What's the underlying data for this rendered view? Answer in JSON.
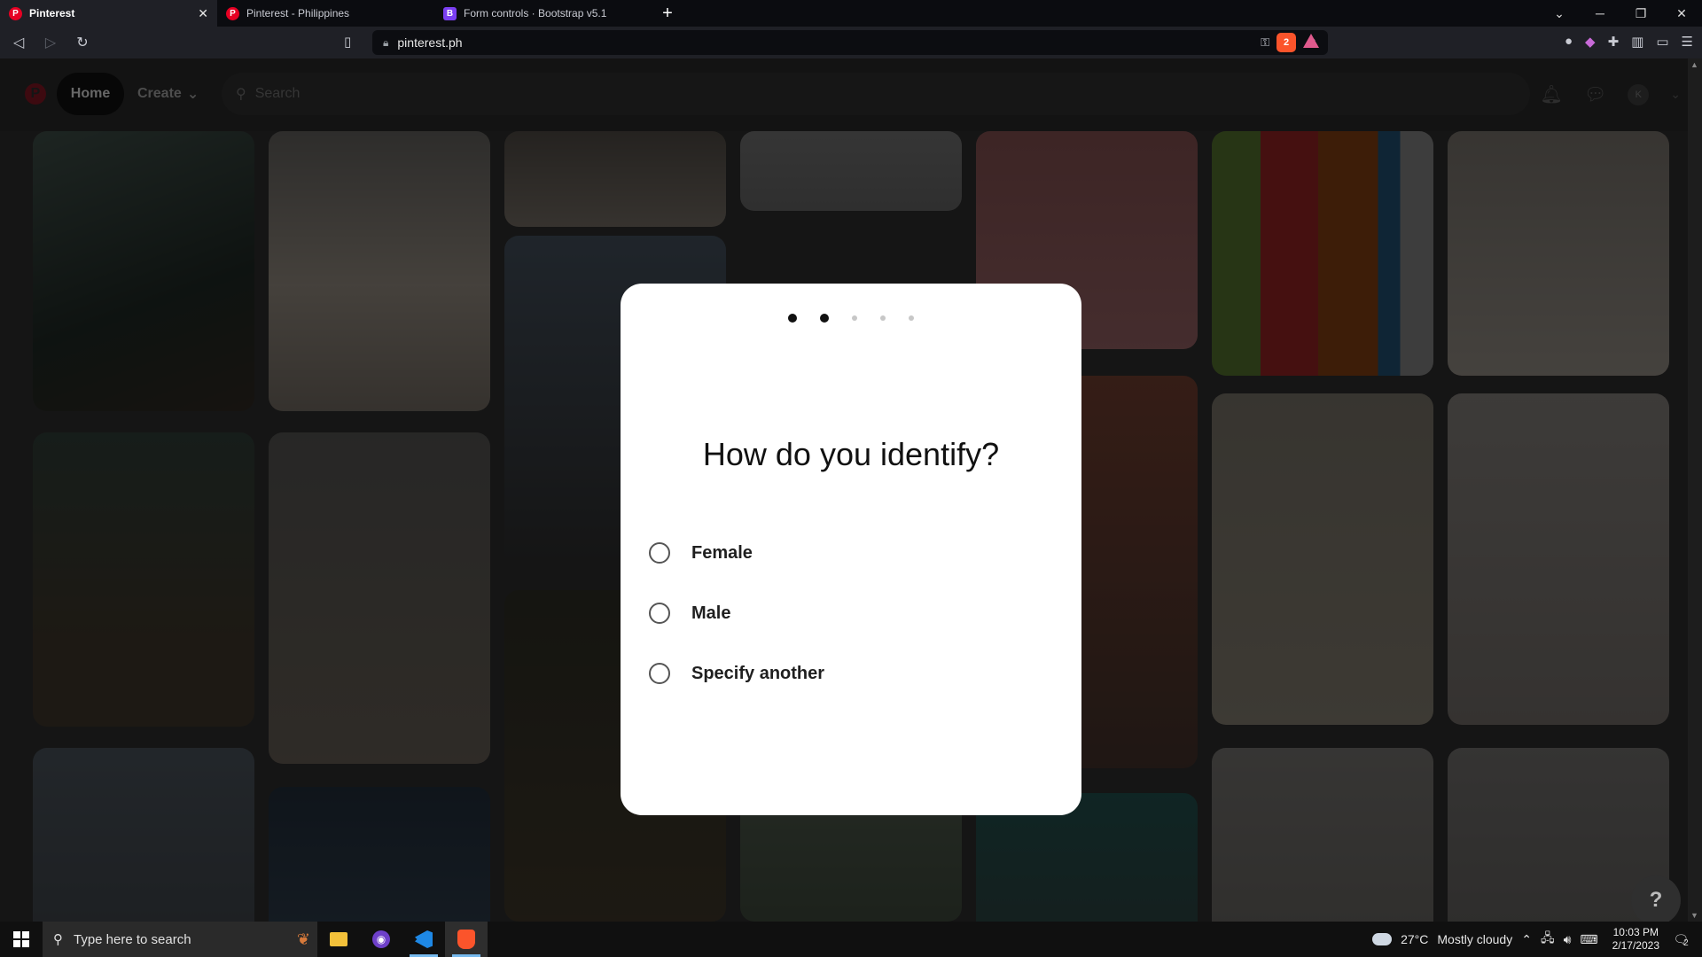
{
  "browser": {
    "tabs": [
      {
        "title": "Pinterest",
        "favicon": "pinterest-icon",
        "active": true
      },
      {
        "title": "Pinterest - Philippines",
        "favicon": "pinterest-icon",
        "active": false
      },
      {
        "title": "Form controls · Bootstrap v5.1",
        "favicon": "bootstrap-icon",
        "active": false
      }
    ],
    "url": "pinterest.ph",
    "brave_shield_count": "2"
  },
  "pinterest": {
    "logo_letter": "P",
    "home_label": "Home",
    "create_label": "Create",
    "search_placeholder": "Search",
    "avatar_initial": "K",
    "help_label": "?"
  },
  "modal": {
    "steps_total": 5,
    "steps_completed": 2,
    "question": "How do you identify?",
    "options": [
      {
        "label": "Female",
        "selected": false
      },
      {
        "label": "Male",
        "selected": false
      },
      {
        "label": "Specify another",
        "selected": false
      }
    ]
  },
  "taskbar": {
    "search_placeholder": "Type here to search",
    "weather_temp": "27°C",
    "weather_desc": "Mostly cloudy",
    "time": "10:03 PM",
    "date": "2/17/2023",
    "notification_count": "2"
  },
  "colors": {
    "pinterest_red": "#e60023",
    "modal_bg": "#ffffff",
    "overlay": "rgba(0,0,0,0.55)"
  }
}
